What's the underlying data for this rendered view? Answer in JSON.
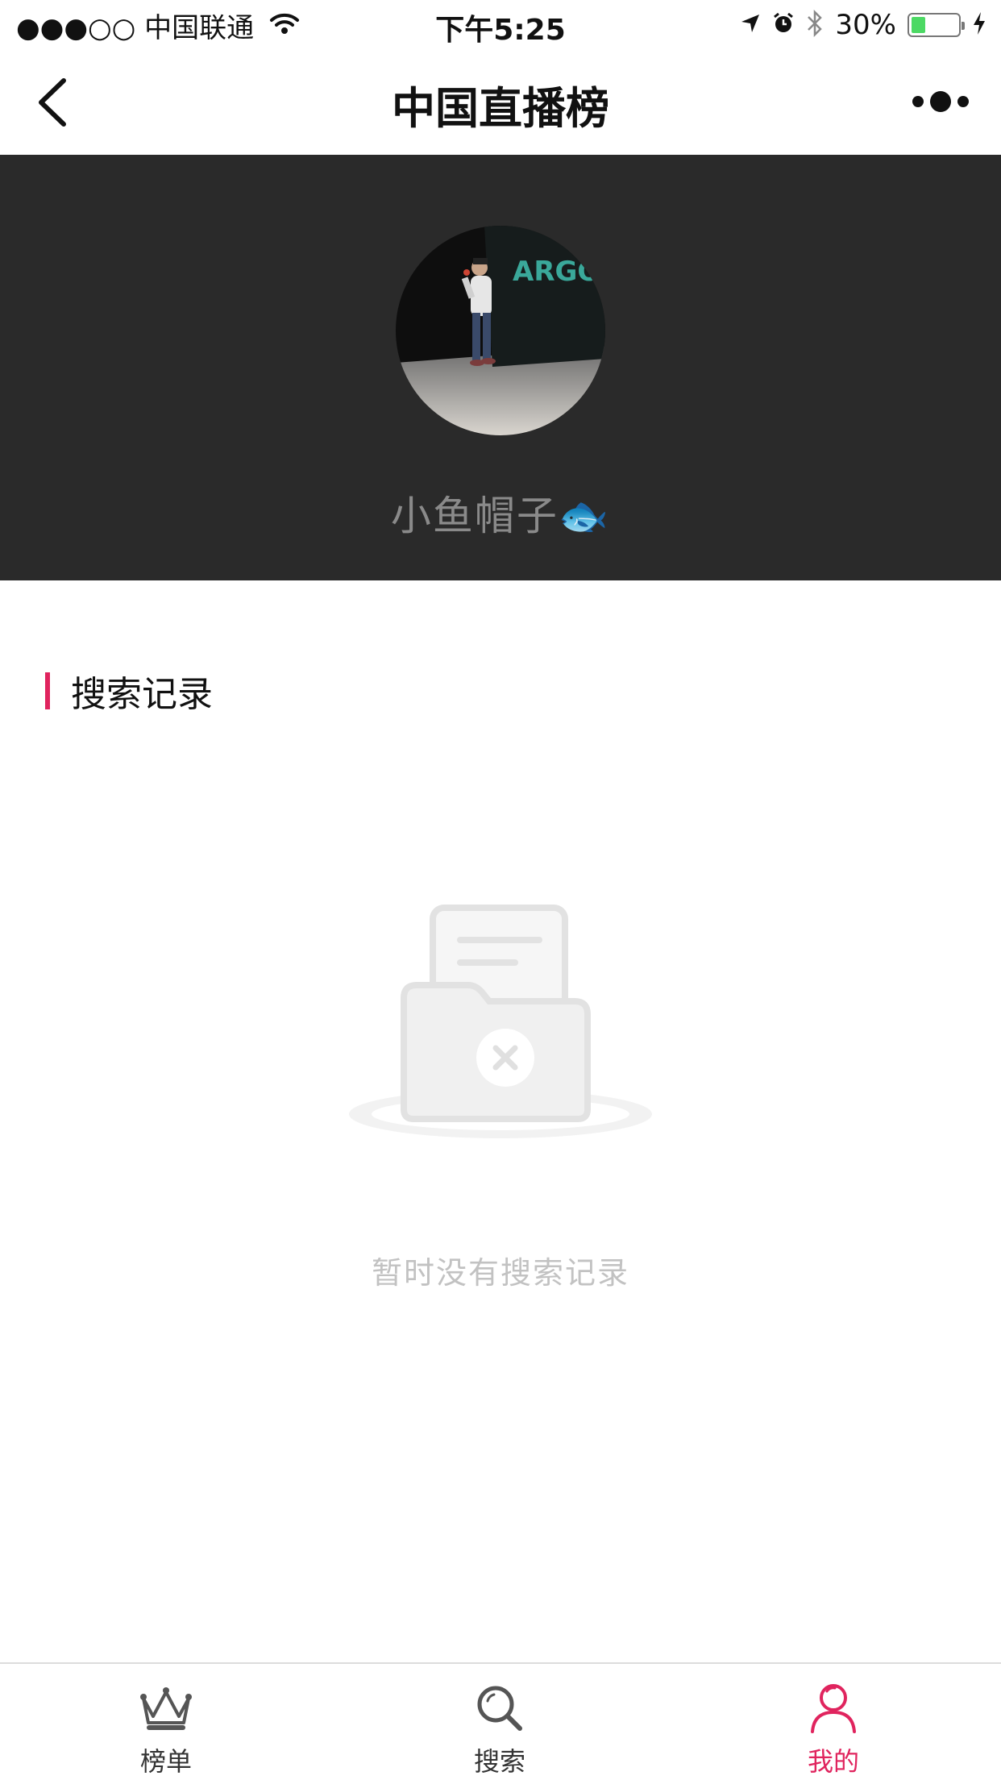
{
  "status_bar": {
    "carrier": "●●●○○ 中国联通",
    "time": "下午5:25",
    "battery_percent": "30%",
    "battery_level": 0.3,
    "icons": [
      "wifi-icon",
      "location-arrow-icon",
      "alarm-icon",
      "bluetooth-icon",
      "battery-icon",
      "charging-icon"
    ]
  },
  "nav": {
    "title": "中国直播榜",
    "back_icon": "chevron-left-icon",
    "more_icon": "more-dots-icon"
  },
  "profile": {
    "username": "小鱼帽子🐟",
    "avatar_text": "ARGO",
    "colors": {
      "header_bg": "#2a2a2a",
      "username": "#8a8a8a"
    }
  },
  "search_history": {
    "section_title": "搜索记录",
    "empty_text": "暂时没有搜索记录",
    "accent_color": "#e0245e"
  },
  "tab_bar": {
    "tabs": [
      {
        "label": "榜单",
        "icon": "crown-icon",
        "active": false
      },
      {
        "label": "搜索",
        "icon": "search-icon",
        "active": false
      },
      {
        "label": "我的",
        "icon": "user-icon",
        "active": true
      }
    ],
    "active_color": "#e0245e"
  }
}
